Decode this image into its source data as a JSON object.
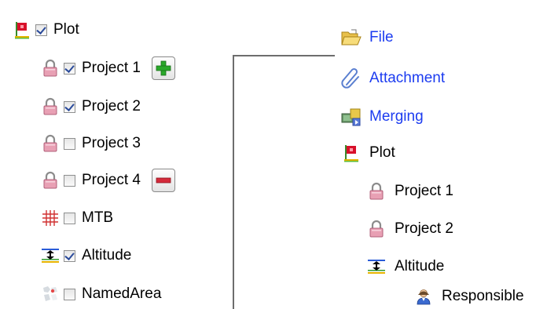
{
  "left_tree": {
    "items": [
      {
        "label": "Plot",
        "icon": "plot-flag-icon",
        "checked": true
      },
      {
        "label": "Project 1",
        "icon": "lock-icon",
        "checked": true
      },
      {
        "label": "Project 2",
        "icon": "lock-icon",
        "checked": true
      },
      {
        "label": "Project 3",
        "icon": "lock-icon",
        "checked": false
      },
      {
        "label": "Project 4",
        "icon": "lock-icon",
        "checked": false
      },
      {
        "label": "MTB",
        "icon": "grid-icon",
        "checked": false
      },
      {
        "label": "Altitude",
        "icon": "altitude-icon",
        "checked": true
      },
      {
        "label": "NamedArea",
        "icon": "named-area-icon",
        "checked": false
      }
    ],
    "add_button_icon": "plus-icon",
    "remove_button_icon": "minus-icon"
  },
  "right_tree": {
    "items": [
      {
        "label": "File",
        "icon": "folder-open-icon",
        "color": "#1c3cf0"
      },
      {
        "label": "Attachment",
        "icon": "paperclip-icon",
        "color": "#1c3cf0"
      },
      {
        "label": "Merging",
        "icon": "merge-icon",
        "color": "#1c3cf0"
      },
      {
        "label": "Plot",
        "icon": "plot-flag-icon",
        "color": "#000000"
      },
      {
        "label": "Project 1",
        "icon": "lock-icon",
        "color": "#000000"
      },
      {
        "label": "Project 2",
        "icon": "lock-icon",
        "color": "#000000"
      },
      {
        "label": "Altitude",
        "icon": "altitude-icon",
        "color": "#000000"
      },
      {
        "label": "Responsible",
        "icon": "person-icon",
        "color": "#000000"
      }
    ]
  },
  "colors": {
    "link": "#1c3cf0",
    "add_green": "#2aa82a",
    "remove_red": "#d42a3a"
  }
}
